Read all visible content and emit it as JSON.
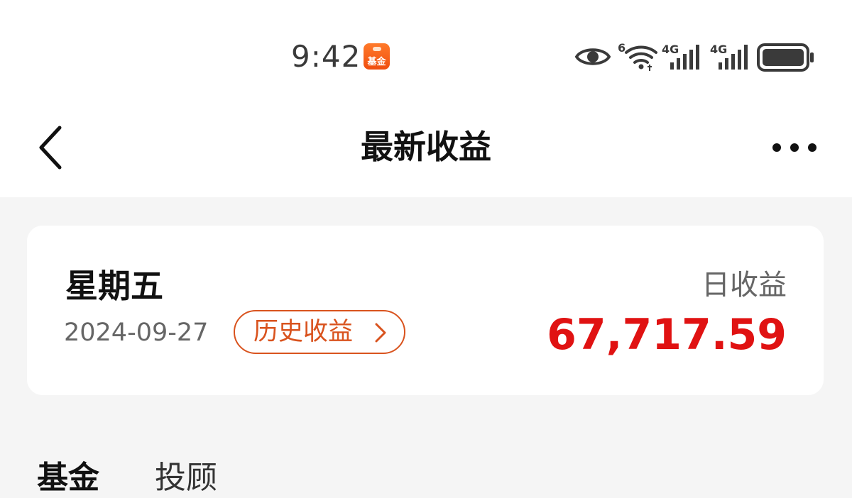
{
  "status_bar": {
    "time": "9:42",
    "app_badge_label": "基金",
    "wifi_label": "6",
    "signal1_label": "4G",
    "signal2_label": "4G",
    "icons": [
      "eye-icon",
      "wifi-icon",
      "signal-icon",
      "signal-icon",
      "battery-icon"
    ]
  },
  "nav": {
    "title": "最新收益",
    "back_icon": "chevron-left-icon",
    "more_icon": "more-horizontal-icon"
  },
  "summary": {
    "weekday": "星期五",
    "date": "2024-09-27",
    "history_button_label": "历史收益",
    "income_label": "日收益",
    "income_value": "67,717.59"
  },
  "tabs": [
    {
      "label": "基金"
    },
    {
      "label": "投顾"
    }
  ],
  "colors": {
    "accent_orange": "#d9531e",
    "income_red": "#e01212",
    "background": "#f5f5f5"
  }
}
